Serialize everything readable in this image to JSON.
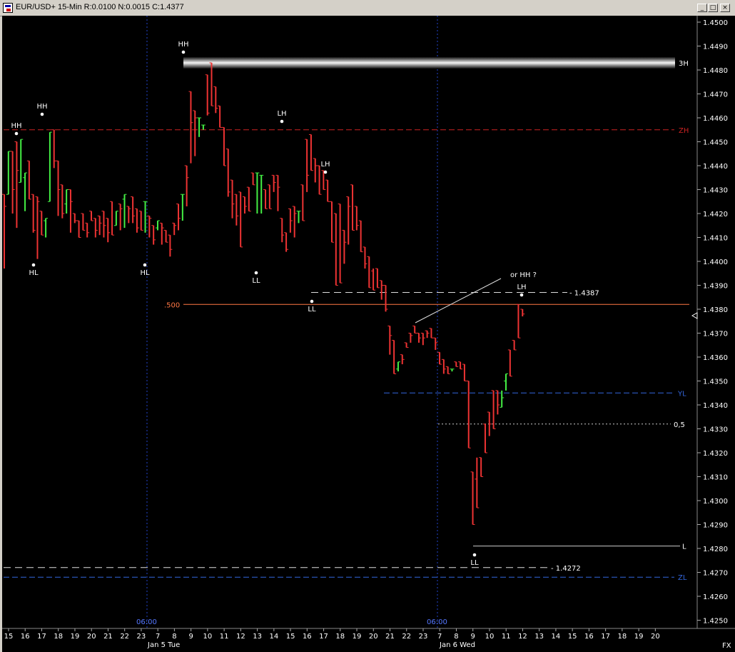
{
  "window": {
    "title": "EUR/USD+ 15-Min R:0.0100 N:0.0015 C:1.4377",
    "minimize_glyph": "_",
    "maximize_glyph": "□",
    "close_glyph": "×"
  },
  "colors": {
    "background": "#000000",
    "up_bar": "#44ee44",
    "down_bar": "#ee3333",
    "vertical_separator": "#2244cc",
    "zh_line": "#cc2222",
    "yl_zl_lines": "#3366dd",
    "fib_line": "#ff7744",
    "axis_text": "#ffffff"
  },
  "chart_data": {
    "type": "bar",
    "symbol": "EUR/USD+",
    "interval": "15-Min",
    "ylim": [
      1.425,
      1.4505
    ],
    "y_ticks": [
      "1.4500",
      "1.4490",
      "1.4480",
      "1.4470",
      "1.4460",
      "1.4450",
      "1.4440",
      "1.4430",
      "1.4420",
      "1.4410",
      "1.4400",
      "1.4390",
      "1.4380",
      "1.4370",
      "1.4360",
      "1.4350",
      "1.4340",
      "1.4330",
      "1.4320",
      "1.4310",
      "1.4300",
      "1.4290",
      "1.4280",
      "1.4270",
      "1.4260",
      "1.4250"
    ],
    "x_labels": [
      "15",
      "16",
      "17",
      "18",
      "19",
      "20",
      "21",
      "22",
      "23",
      "7",
      "8",
      "9",
      "10",
      "11",
      "12",
      "13",
      "14",
      "15",
      "16",
      "17",
      "18",
      "19",
      "20",
      "21",
      "22",
      "23",
      "7",
      "8",
      "9",
      "10",
      "11",
      "12",
      "13",
      "14",
      "15",
      "16",
      "17",
      "18",
      "19",
      "20"
    ],
    "date_labels": [
      "Jan 5 Tue",
      "Jan 6 Wed"
    ],
    "time_marks": [
      "06:00",
      "06:00"
    ],
    "corner_label": "FX",
    "bars": [
      [
        1.4428,
        1.4423,
        1.4397
      ],
      [
        1.4428,
        1.4446,
        1.4437
      ],
      [
        1.4446,
        1.443,
        1.442
      ],
      [
        1.445,
        1.4438,
        1.4414
      ],
      [
        1.4433,
        1.4451,
        1.4437
      ],
      [
        1.4435,
        1.4437,
        1.4421
      ],
      [
        1.4442,
        1.4426,
        1.4426
      ],
      [
        1.4428,
        1.4413,
        1.4412
      ],
      [
        1.4427,
        1.4425,
        1.4401
      ],
      [
        1.4421,
        1.4411,
        1.4412
      ],
      [
        1.4417,
        1.4418,
        1.441
      ],
      [
        1.4425,
        1.4454,
        1.4432
      ],
      [
        1.4455,
        1.4442,
        1.4439
      ],
      [
        1.4442,
        1.443,
        1.4419
      ],
      [
        1.4432,
        1.442,
        1.4418
      ],
      [
        1.4424,
        1.443,
        1.442
      ],
      [
        1.443,
        1.4425,
        1.4412
      ],
      [
        1.442,
        1.4417,
        1.4416
      ],
      [
        1.4417,
        1.441,
        1.4415
      ],
      [
        1.442,
        1.4413,
        1.4415
      ],
      [
        1.4416,
        1.4412,
        1.441
      ],
      [
        1.4421,
        1.4417,
        1.4417
      ],
      [
        1.4418,
        1.4413,
        1.441
      ],
      [
        1.4419,
        1.4416,
        1.4411
      ],
      [
        1.4421,
        1.4415,
        1.441
      ],
      [
        1.4418,
        1.4412,
        1.4408
      ],
      [
        1.4425,
        1.4411,
        1.4413
      ],
      [
        1.4415,
        1.4421,
        1.442
      ],
      [
        1.4424,
        1.4422,
        1.4413
      ],
      [
        1.4426,
        1.4428,
        1.4414
      ],
      [
        1.4423,
        1.4422,
        1.4416
      ],
      [
        1.4427,
        1.4419,
        1.4416
      ],
      [
        1.4422,
        1.4414,
        1.4412
      ],
      [
        1.4421,
        1.4413,
        1.4415
      ],
      [
        1.4425,
        1.4425,
        1.4412
      ],
      [
        1.4419,
        1.4418,
        1.441
      ],
      [
        1.4415,
        1.4409,
        1.4407
      ],
      [
        1.4414,
        1.4417,
        1.4413
      ],
      [
        1.4416,
        1.4414,
        1.4407
      ],
      [
        1.4413,
        1.4408,
        1.441
      ],
      [
        1.4411,
        1.4405,
        1.4402
      ],
      [
        1.4416,
        1.4415,
        1.4411
      ],
      [
        1.4424,
        1.4418,
        1.4413
      ],
      [
        1.4428,
        1.4428,
        1.4417
      ],
      [
        1.444,
        1.4435,
        1.4423
      ],
      [
        1.4471,
        1.4458,
        1.4441
      ],
      [
        1.4463,
        1.446,
        1.4444
      ],
      [
        1.446,
        1.446,
        1.4452
      ],
      [
        1.4457,
        1.4457,
        1.4455
      ],
      [
        1.4478,
        1.4462,
        1.4461
      ],
      [
        1.4483,
        1.4465,
        1.4476
      ],
      [
        1.4473,
        1.4464,
        1.4462
      ],
      [
        1.4465,
        1.4456,
        1.4458
      ],
      [
        1.4456,
        1.444,
        1.4445
      ],
      [
        1.4447,
        1.4429,
        1.4427
      ],
      [
        1.4434,
        1.4424,
        1.4418
      ],
      [
        1.4428,
        1.4419,
        1.4415
      ],
      [
        1.4429,
        1.4406,
        1.441
      ],
      [
        1.4427,
        1.4423,
        1.442
      ],
      [
        1.4431,
        1.4421,
        1.4425
      ],
      [
        1.4437,
        1.4432,
        1.4433
      ],
      [
        1.4437,
        1.4437,
        1.442
      ],
      [
        1.4436,
        1.4436,
        1.442
      ],
      [
        1.443,
        1.4422,
        1.4428
      ],
      [
        1.4432,
        1.4422,
        1.443
      ],
      [
        1.4436,
        1.4433,
        1.4429
      ],
      [
        1.4436,
        1.4431,
        1.4421
      ],
      [
        1.4418,
        1.4411,
        1.4408
      ],
      [
        1.4412,
        1.4405,
        1.4404
      ],
      [
        1.4422,
        1.4417,
        1.4412
      ],
      [
        1.4423,
        1.442,
        1.441
      ],
      [
        1.4421,
        1.4421,
        1.4416
      ],
      [
        1.4432,
        1.4417,
        1.4421
      ],
      [
        1.4451,
        1.4436,
        1.4429
      ],
      [
        1.4453,
        1.4438,
        1.4451
      ],
      [
        1.4443,
        1.444,
        1.4433
      ],
      [
        1.444,
        1.4428,
        1.4438
      ],
      [
        1.4438,
        1.443,
        1.4438
      ],
      [
        1.4434,
        1.4425,
        1.4426
      ],
      [
        1.4425,
        1.4408,
        1.4415
      ],
      [
        1.442,
        1.439,
        1.4402
      ],
      [
        1.4424,
        1.4391,
        1.44
      ],
      [
        1.4413,
        1.4408,
        1.4399
      ],
      [
        1.4427,
        1.4423,
        1.4407
      ],
      [
        1.4432,
        1.4413,
        1.4425
      ],
      [
        1.4423,
        1.4415,
        1.4413
      ],
      [
        1.4417,
        1.4404,
        1.441
      ],
      [
        1.4406,
        1.4399,
        1.4397
      ],
      [
        1.4402,
        1.4389,
        1.439
      ],
      [
        1.4396,
        1.4388,
        1.4397
      ],
      [
        1.4397,
        1.4389,
        1.4394
      ],
      [
        1.4392,
        1.439,
        1.4384
      ],
      [
        1.439,
        1.438,
        1.4379
      ],
      [
        1.4373,
        1.4369,
        1.4361
      ],
      [
        1.4367,
        1.4353,
        1.436
      ],
      [
        1.4355,
        1.4358,
        1.4354
      ],
      [
        1.4361,
        1.4359,
        1.4357
      ],
      [
        1.4366,
        1.4364,
        1.4364
      ],
      [
        1.437,
        1.4369,
        1.4366
      ],
      [
        1.4373,
        1.437,
        1.4372
      ],
      [
        1.437,
        1.4368,
        1.4366
      ],
      [
        1.437,
        1.4368,
        1.4365
      ],
      [
        1.4371,
        1.437,
        1.4368
      ],
      [
        1.4372,
        1.4368,
        1.4368
      ],
      [
        1.4368,
        1.4366,
        1.4363
      ],
      [
        1.4362,
        1.4357,
        1.4359
      ],
      [
        1.4359,
        1.4355,
        1.4353
      ],
      [
        1.4356,
        1.4353,
        1.4355
      ],
      [
        1.4355,
        1.4355,
        1.4354
      ],
      [
        1.4358,
        1.4356,
        1.4356
      ],
      [
        1.4358,
        1.4355,
        1.4357
      ],
      [
        1.4357,
        1.435,
        1.4354
      ],
      [
        1.435,
        1.4322,
        1.4328
      ],
      [
        1.4312,
        1.429,
        1.4294
      ],
      [
        1.4309,
        1.4297,
        1.4318
      ],
      [
        1.4318,
        1.431,
        1.4316
      ],
      [
        1.4332,
        1.432,
        1.4329
      ],
      [
        1.4337,
        1.4332,
        1.4327
      ],
      [
        1.4346,
        1.433,
        1.4341
      ],
      [
        1.4346,
        1.434,
        1.4336
      ],
      [
        1.4339,
        1.4343,
        1.4346
      ],
      [
        1.435,
        1.4353,
        1.4346
      ],
      [
        1.4363,
        1.4352,
        1.4361
      ],
      [
        1.4367,
        1.4363,
        1.4365
      ],
      [
        1.4382,
        1.4368,
        1.438
      ],
      [
        1.438,
        1.4378,
        1.4377
      ]
    ],
    "levels": [
      {
        "id": "3H",
        "label": "3H",
        "price": 1.4483
      },
      {
        "id": "ZH",
        "label": "ZH",
        "price": 1.4455
      },
      {
        "id": "fib",
        "label": ".500",
        "price": 1.4382
      },
      {
        "id": "resist",
        "label": "- 1.4387",
        "price": 1.4387
      },
      {
        "id": "YL",
        "label": "YL",
        "price": 1.4345
      },
      {
        "id": "half",
        "label": "0,5",
        "price": 1.4332
      },
      {
        "id": "L",
        "label": "L",
        "price": 1.4281
      },
      {
        "id": "support",
        "label": "- 1.4272",
        "price": 1.4272
      },
      {
        "id": "ZL",
        "label": "ZL",
        "price": 1.4268
      }
    ],
    "swing_labels": [
      "HH",
      "HH",
      "HL",
      "HH",
      "HL",
      "LH",
      "LL",
      "LH",
      "LL",
      "LH",
      "LL"
    ],
    "annotation": "or HH ?"
  }
}
